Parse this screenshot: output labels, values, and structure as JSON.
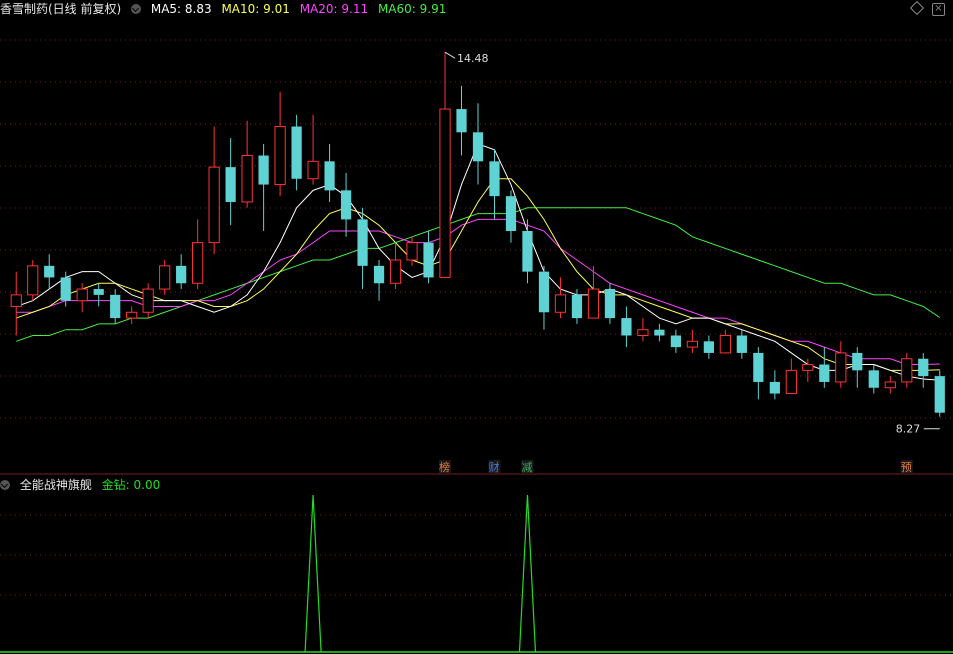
{
  "header": {
    "title": "香雪制药(日线 前复权)",
    "ma5": "MA5: 8.83",
    "ma10": "MA10: 9.01",
    "ma20": "MA20: 9.11",
    "ma60": "MA60: 9.91"
  },
  "indicator": {
    "name": "全能战神旗舰",
    "value": "金钻: 0.00"
  },
  "annotations": {
    "high": "14.48",
    "low": "8.27"
  },
  "markers": [
    {
      "label": "榜",
      "color": "#e07a3a"
    },
    {
      "label": "财",
      "color": "#4a7bd6"
    },
    {
      "label": "减",
      "color": "#3caa5c"
    },
    {
      "label": "预",
      "color": "#e07a3a"
    }
  ],
  "colors": {
    "up": "#ff3333",
    "down": "#5fd3d3",
    "ma5": "#ffffff",
    "ma10": "#ffff55",
    "ma20": "#ff44ff",
    "ma60": "#44ee44",
    "indicator": "#22dd22"
  },
  "chart_data": [
    {
      "type": "candlestick",
      "ylim": [
        7.8,
        15.0
      ],
      "series_ma": {
        "ma5": [
          10.1,
          10.2,
          10.4,
          10.6,
          10.7,
          10.7,
          10.5,
          10.3,
          10.2,
          10.2,
          10.2,
          10.1,
          10.0,
          10.1,
          10.3,
          10.7,
          11.2,
          11.8,
          12.1,
          12.2,
          12.0,
          11.6,
          11.1,
          10.8,
          10.6,
          10.7,
          11.3,
          12.2,
          12.9,
          12.8,
          12.2,
          11.4,
          10.7,
          10.4,
          10.3,
          10.3,
          10.4,
          10.3,
          10.1,
          9.9,
          9.8,
          9.9,
          9.9,
          9.8,
          9.7,
          9.6,
          9.5,
          9.3,
          9.1,
          9.0,
          9.0,
          9.1,
          9.1,
          9.0,
          8.9,
          8.85,
          8.83
        ],
        "ma10": [
          9.9,
          10.0,
          10.1,
          10.3,
          10.4,
          10.5,
          10.5,
          10.4,
          10.3,
          10.2,
          10.2,
          10.2,
          10.1,
          10.1,
          10.2,
          10.4,
          10.7,
          11.0,
          11.4,
          11.7,
          11.8,
          11.7,
          11.5,
          11.2,
          10.9,
          10.8,
          10.9,
          11.4,
          11.9,
          12.3,
          12.3,
          12.0,
          11.6,
          11.1,
          10.7,
          10.4,
          10.3,
          10.3,
          10.2,
          10.1,
          10.0,
          9.9,
          9.9,
          9.8,
          9.8,
          9.7,
          9.6,
          9.5,
          9.4,
          9.2,
          9.1,
          9.1,
          9.1,
          9.0,
          9.0,
          9.0,
          9.01
        ],
        "ma20": [
          10.0,
          10.0,
          10.1,
          10.2,
          10.2,
          10.2,
          10.2,
          10.2,
          10.1,
          10.1,
          10.1,
          10.2,
          10.2,
          10.3,
          10.5,
          10.7,
          10.9,
          11.0,
          11.2,
          11.4,
          11.4,
          11.4,
          11.4,
          11.3,
          11.2,
          11.2,
          11.3,
          11.5,
          11.6,
          11.6,
          11.6,
          11.5,
          11.4,
          11.1,
          10.9,
          10.7,
          10.5,
          10.4,
          10.3,
          10.2,
          10.1,
          10.0,
          9.9,
          9.9,
          9.8,
          9.7,
          9.6,
          9.5,
          9.5,
          9.4,
          9.3,
          9.2,
          9.2,
          9.2,
          9.1,
          9.1,
          9.11
        ],
        "ma60": [
          9.5,
          9.6,
          9.6,
          9.7,
          9.7,
          9.8,
          9.8,
          9.9,
          9.9,
          10.0,
          10.1,
          10.2,
          10.3,
          10.4,
          10.5,
          10.6,
          10.7,
          10.8,
          10.9,
          10.9,
          11.0,
          11.1,
          11.1,
          11.2,
          11.3,
          11.4,
          11.5,
          11.6,
          11.7,
          11.7,
          11.7,
          11.8,
          11.8,
          11.8,
          11.8,
          11.8,
          11.8,
          11.8,
          11.7,
          11.6,
          11.5,
          11.3,
          11.2,
          11.1,
          11.0,
          10.9,
          10.8,
          10.7,
          10.6,
          10.5,
          10.5,
          10.4,
          10.3,
          10.3,
          10.2,
          10.1,
          9.91
        ]
      },
      "candles": [
        [
          10.1,
          10.3,
          9.6,
          10.7
        ],
        [
          10.3,
          10.8,
          10.2,
          10.9
        ],
        [
          10.8,
          10.6,
          10.4,
          11.0
        ],
        [
          10.6,
          10.2,
          10.1,
          10.7
        ],
        [
          10.2,
          10.4,
          10.0,
          10.5
        ],
        [
          10.4,
          10.3,
          10.1,
          10.5
        ],
        [
          10.3,
          9.9,
          9.8,
          10.4
        ],
        [
          9.9,
          10.0,
          9.8,
          10.1
        ],
        [
          10.0,
          10.4,
          9.9,
          10.5
        ],
        [
          10.4,
          10.8,
          10.3,
          10.9
        ],
        [
          10.8,
          10.5,
          10.4,
          11.0
        ],
        [
          10.5,
          11.2,
          10.4,
          11.6
        ],
        [
          11.2,
          12.5,
          11.0,
          13.2
        ],
        [
          12.5,
          11.9,
          11.5,
          13.0
        ],
        [
          11.9,
          12.7,
          11.8,
          13.3
        ],
        [
          12.7,
          12.2,
          11.4,
          12.9
        ],
        [
          12.2,
          13.2,
          12.0,
          13.8
        ],
        [
          13.2,
          12.3,
          12.1,
          13.4
        ],
        [
          12.3,
          12.6,
          12.2,
          13.4
        ],
        [
          12.6,
          12.1,
          11.9,
          12.9
        ],
        [
          12.1,
          11.6,
          11.3,
          12.4
        ],
        [
          11.6,
          10.8,
          10.4,
          11.8
        ],
        [
          10.8,
          10.5,
          10.2,
          10.9
        ],
        [
          10.5,
          10.9,
          10.4,
          11.2
        ],
        [
          10.9,
          11.2,
          10.8,
          11.3
        ],
        [
          11.2,
          10.6,
          10.5,
          11.4
        ],
        [
          10.6,
          13.5,
          10.6,
          14.48
        ],
        [
          13.5,
          13.1,
          12.7,
          13.9
        ],
        [
          13.1,
          12.6,
          12.2,
          13.6
        ],
        [
          12.6,
          12.0,
          11.6,
          12.8
        ],
        [
          12.0,
          11.4,
          11.2,
          12.1
        ],
        [
          11.4,
          10.7,
          10.5,
          11.6
        ],
        [
          10.7,
          10.0,
          9.7,
          10.8
        ],
        [
          10.0,
          10.3,
          9.9,
          10.6
        ],
        [
          10.3,
          9.9,
          9.8,
          10.4
        ],
        [
          9.9,
          10.4,
          9.9,
          10.8
        ],
        [
          10.4,
          9.9,
          9.8,
          10.5
        ],
        [
          9.9,
          9.6,
          9.4,
          10.1
        ],
        [
          9.6,
          9.7,
          9.5,
          9.9
        ],
        [
          9.7,
          9.6,
          9.5,
          9.8
        ],
        [
          9.6,
          9.4,
          9.3,
          9.7
        ],
        [
          9.4,
          9.5,
          9.3,
          9.7
        ],
        [
          9.5,
          9.3,
          9.2,
          9.6
        ],
        [
          9.3,
          9.6,
          9.3,
          9.7
        ],
        [
          9.6,
          9.3,
          9.2,
          9.7
        ],
        [
          9.3,
          8.8,
          8.5,
          9.4
        ],
        [
          8.8,
          8.6,
          8.5,
          9.0
        ],
        [
          8.6,
          9.0,
          8.6,
          9.2
        ],
        [
          9.0,
          9.1,
          8.8,
          9.2
        ],
        [
          9.1,
          8.8,
          8.7,
          9.4
        ],
        [
          8.8,
          9.3,
          8.7,
          9.5
        ],
        [
          9.3,
          9.0,
          8.7,
          9.4
        ],
        [
          9.0,
          8.7,
          8.6,
          9.1
        ],
        [
          8.7,
          8.8,
          8.6,
          8.9
        ],
        [
          8.8,
          9.2,
          8.7,
          9.3
        ],
        [
          9.2,
          8.9,
          8.7,
          9.3
        ],
        [
          8.9,
          8.27,
          8.2,
          9.0
        ]
      ]
    },
    {
      "type": "line",
      "name": "金钻",
      "peaks_at_candle": [
        18,
        31
      ],
      "ylim": [
        0,
        1
      ]
    }
  ]
}
